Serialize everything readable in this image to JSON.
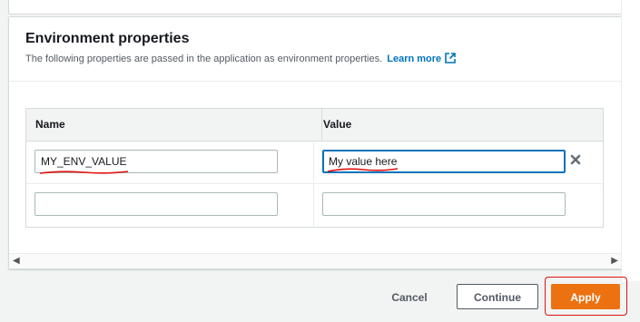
{
  "section": {
    "title": "Environment properties",
    "description": "The following properties are passed in the application as environment properties.",
    "learn_more": "Learn more"
  },
  "table": {
    "columns": [
      "Name",
      "Value"
    ],
    "rows": [
      {
        "name": "MY_ENV_VALUE",
        "value": "My value here"
      },
      {
        "name": "",
        "value": ""
      }
    ]
  },
  "icons": {
    "external_link": "external-link-icon",
    "remove": "close-icon",
    "scroll_left": "chevron-left-icon",
    "scroll_right": "chevron-right-icon"
  },
  "footer": {
    "cancel": "Cancel",
    "continue": "Continue",
    "apply": "Apply"
  },
  "colors": {
    "link": "#0073bb",
    "primary": "#ec7211",
    "annotation": "#e01010"
  }
}
